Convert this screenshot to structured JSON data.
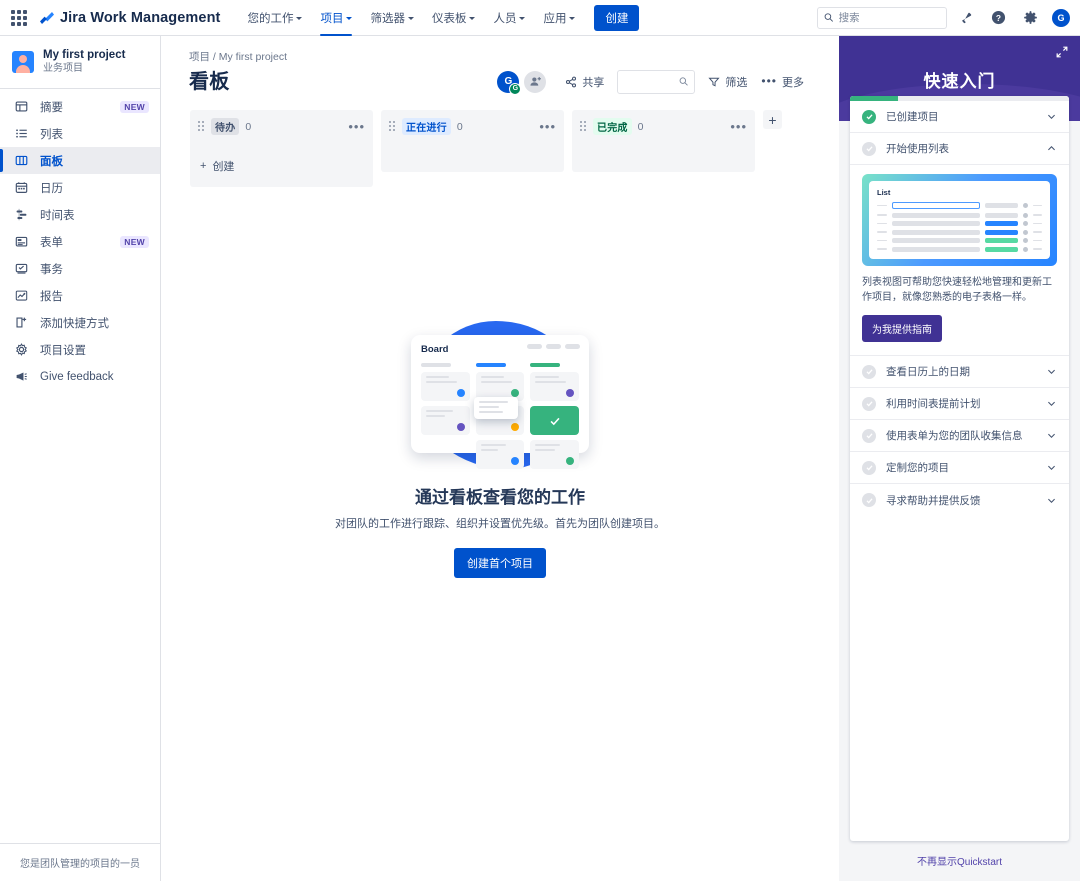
{
  "topnav": {
    "apps_icon": "apps-grid-icon",
    "brand": "Jira Work Management",
    "items": [
      {
        "label": "您的工作",
        "active": false
      },
      {
        "label": "项目",
        "active": true
      },
      {
        "label": "筛选器",
        "active": false
      },
      {
        "label": "仪表板",
        "active": false
      },
      {
        "label": "人员",
        "active": false
      },
      {
        "label": "应用",
        "active": false
      }
    ],
    "create_label": "创建",
    "search_placeholder": "搜索",
    "search_value": "",
    "icons": [
      "notification-bell-icon",
      "help-icon",
      "settings-gear-icon"
    ],
    "avatar_initial": "G"
  },
  "sidebar": {
    "project_name": "My first project",
    "project_type": "业务项目",
    "items": [
      {
        "label": "摘要",
        "icon": "summary-icon",
        "badge": "NEW",
        "active": false
      },
      {
        "label": "列表",
        "icon": "list-icon",
        "badge": "",
        "active": false
      },
      {
        "label": "面板",
        "icon": "board-icon",
        "badge": "",
        "active": true
      },
      {
        "label": "日历",
        "icon": "calendar-icon",
        "badge": "",
        "active": false
      },
      {
        "label": "时间表",
        "icon": "timeline-icon",
        "badge": "",
        "active": false
      },
      {
        "label": "表单",
        "icon": "forms-icon",
        "badge": "NEW",
        "active": false
      },
      {
        "label": "事务",
        "icon": "issues-icon",
        "badge": "",
        "active": false
      },
      {
        "label": "报告",
        "icon": "reports-icon",
        "badge": "",
        "active": false
      },
      {
        "label": "添加快捷方式",
        "icon": "add-shortcut-icon",
        "badge": "",
        "active": false
      },
      {
        "label": "项目设置",
        "icon": "project-settings-icon",
        "badge": "",
        "active": false
      },
      {
        "label": "Give feedback",
        "icon": "megaphone-icon",
        "badge": "",
        "active": false
      }
    ],
    "footer": "您是团队管理的项目的一员"
  },
  "main": {
    "breadcrumb_root": "项目",
    "breadcrumb_sep": "/",
    "breadcrumb_current": "My first project",
    "title": "看板",
    "avatar_initial": "G",
    "avatar_badge": "G",
    "share_label": "共享",
    "search_placeholder": "",
    "search_value": "",
    "filter_label": "筛选",
    "more_label": "更多",
    "add_column_label": "+",
    "columns": [
      {
        "name": "待办",
        "count": "0",
        "style": "todo",
        "create_label": "创建"
      },
      {
        "name": "正在进行",
        "count": "0",
        "style": "prog",
        "create_label": ""
      },
      {
        "name": "已完成",
        "count": "0",
        "style": "done",
        "create_label": ""
      }
    ],
    "empty": {
      "art_title": "Board",
      "heading": "通过看板查看您的工作",
      "description": "对团队的工作进行跟踪、组织并设置优先级。首先为团队创建项目。",
      "button": "创建首个项目"
    }
  },
  "quickstart": {
    "title": "快速入门",
    "collapse_icon": "collapse-icon",
    "progress_percent": 22,
    "items": [
      {
        "label": "已创建项目",
        "done": true,
        "expanded": false
      },
      {
        "label": "开始使用列表",
        "done": false,
        "expanded": true
      },
      {
        "label": "查看日历上的日期",
        "done": false,
        "expanded": false
      },
      {
        "label": "利用时间表提前计划",
        "done": false,
        "expanded": false
      },
      {
        "label": "使用表单为您的团队收集信息",
        "done": false,
        "expanded": false
      },
      {
        "label": "定制您的项目",
        "done": false,
        "expanded": false
      },
      {
        "label": "寻求帮助并提供反馈",
        "done": false,
        "expanded": false
      }
    ],
    "panel": {
      "image_title": "List",
      "description": "列表视图可帮助您快速轻松地管理和更新工作项目，就像您熟悉的电子表格一样。",
      "cta": "为我提供指南"
    },
    "dismiss": "不再显示Quickstart"
  },
  "colors": {
    "brand_blue": "#0052cc",
    "purple": "#403294",
    "green": "#36b37e",
    "text": "#172b4d"
  }
}
